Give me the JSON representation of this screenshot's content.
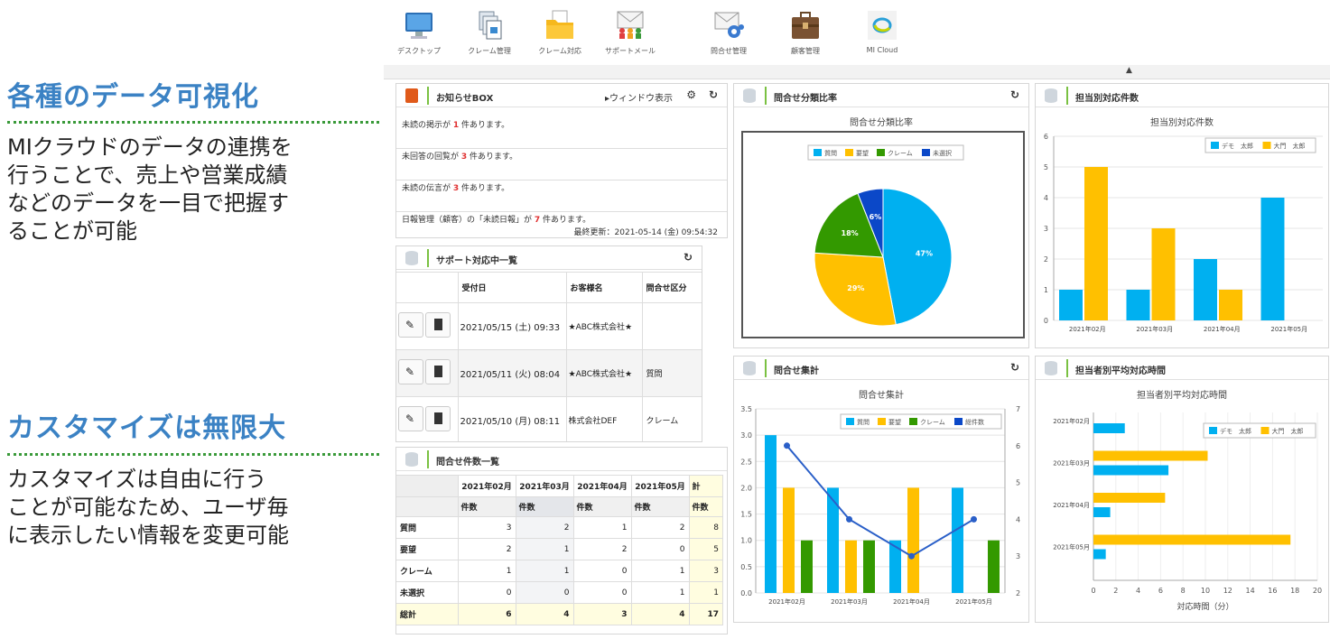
{
  "left": {
    "section1": {
      "heading": "各種のデータ可視化",
      "body": "MIクラウドのデータの連携を\n行うことで、売上や営業成績\nなどのデータを一目で把握す\nることが可能"
    },
    "section2": {
      "heading": "カスタマイズは無限大",
      "body": "カスタマイズは自由に行う\nことが可能なため、ユーザ毎\nに表示したい情報を変更可能"
    }
  },
  "toolbar": [
    {
      "label": "デスクトップ",
      "icon": "monitor-icon"
    },
    {
      "label": "クレーム管理",
      "icon": "documents-icon"
    },
    {
      "label": "クレーム対応",
      "icon": "folder-icon"
    },
    {
      "label": "サポートメール",
      "icon": "mail-people-icon"
    },
    {
      "label": "問合せ管理",
      "icon": "mail-gear-icon"
    },
    {
      "label": "顧客管理",
      "icon": "briefcase-icon"
    },
    {
      "label": "MI Cloud",
      "icon": "cloud-logo-icon"
    }
  ],
  "notice": {
    "title": "お知らせBOX",
    "window_label": "▸ウィンドウ表示",
    "items": [
      {
        "pre": "未読の掲示が ",
        "num": "1",
        "post": " 件あります。"
      },
      {
        "pre": "未回答の回覧が ",
        "num": "3",
        "post": " 件あります。"
      },
      {
        "pre": "未読の伝言が ",
        "num": "3",
        "post": " 件あります。"
      },
      {
        "pre": "日報管理（顧客）の「未読日報」が ",
        "num": "7",
        "post": " 件あります。"
      }
    ],
    "updated": "最終更新：2021-05-14 (金) 09:54:32"
  },
  "support": {
    "title": "サポート対応中一覧",
    "headers": [
      "受付日",
      "お客様名",
      "問合せ区分"
    ],
    "rows": [
      {
        "date": "2021/05/15 (土) 09:33",
        "customer": "★ABC株式会社★",
        "category": ""
      },
      {
        "date": "2021/05/11 (火) 08:04",
        "customer": "★ABC株式会社★",
        "category": "質問"
      },
      {
        "date": "2021/05/10 (月) 08:11",
        "customer": "株式会社DEF",
        "category": "クレーム"
      }
    ]
  },
  "count_table": {
    "title": "問合せ件数一覧",
    "months": [
      "2021年02月",
      "2021年03月",
      "2021年04月",
      "2021年05月",
      "計"
    ],
    "sub": [
      "件数",
      "件数",
      "件数",
      "件数",
      "件数"
    ],
    "rows": [
      {
        "label": "質問",
        "values": [
          "3",
          "2",
          "1",
          "2",
          "8"
        ]
      },
      {
        "label": "要望",
        "values": [
          "2",
          "1",
          "2",
          "0",
          "5"
        ]
      },
      {
        "label": "クレーム",
        "values": [
          "1",
          "1",
          "0",
          "1",
          "3"
        ]
      },
      {
        "label": "未選択",
        "values": [
          "0",
          "0",
          "0",
          "1",
          "1"
        ]
      },
      {
        "label": "総計",
        "values": [
          "6",
          "4",
          "3",
          "4",
          "17"
        ]
      }
    ]
  },
  "panels": {
    "pie": {
      "header": "問合せ分類比率"
    },
    "bar": {
      "header": "担当別対応件数"
    },
    "combo": {
      "header": "問合せ集計"
    },
    "hbar": {
      "header": "担当者別平均対応時間"
    }
  },
  "colors": {
    "c1": "#00b0f0",
    "c2": "#ffc000",
    "c3": "#339900",
    "c4": "#0b48c8",
    "accent": "#7ac142",
    "heading": "#3b82c4"
  },
  "chart_data": [
    {
      "type": "pie",
      "title": "問合せ分類比率",
      "legend": [
        "質問",
        "要望",
        "クレーム",
        "未選択"
      ],
      "values": [
        47,
        29,
        18,
        6
      ],
      "labels": [
        "47%",
        "29%",
        "18%",
        "6%"
      ]
    },
    {
      "type": "bar",
      "title": "担当別対応件数",
      "categories": [
        "2021年02月",
        "2021年03月",
        "2021年04月",
        "2021年05月"
      ],
      "series": [
        {
          "name": "デモ　太郎",
          "values": [
            1,
            1,
            2,
            4
          ]
        },
        {
          "name": "大門　太郎",
          "values": [
            5,
            3,
            1,
            0
          ]
        }
      ],
      "ylim": [
        0,
        6
      ],
      "yticks": [
        "0",
        "1",
        "2",
        "3",
        "4",
        "5",
        "6"
      ]
    },
    {
      "type": "bar",
      "title": "問合せ集計",
      "categories": [
        "2021年02月",
        "2021年03月",
        "2021年04月",
        "2021年05月"
      ],
      "series": [
        {
          "name": "質問",
          "values": [
            3,
            2,
            1,
            2
          ]
        },
        {
          "name": "要望",
          "values": [
            2,
            1,
            2,
            0
          ]
        },
        {
          "name": "クレーム",
          "values": [
            1,
            1,
            0,
            1
          ]
        },
        {
          "name": "総件数",
          "type": "line",
          "axis": "right",
          "values": [
            6,
            4,
            3,
            4
          ]
        }
      ],
      "ylim": [
        0,
        3.5
      ],
      "yticks": [
        "0.0",
        "0.5",
        "1.0",
        "1.5",
        "2.0",
        "2.5",
        "3.0",
        "3.5"
      ],
      "y2lim": [
        2,
        7
      ],
      "y2ticks": [
        "2",
        "3",
        "4",
        "5",
        "6",
        "7"
      ]
    },
    {
      "type": "bar",
      "title": "担当者別平均対応時間",
      "orientation": "horizontal",
      "categories": [
        "2021年02月",
        "2021年03月",
        "2021年04月",
        "2021年05月"
      ],
      "series": [
        {
          "name": "デモ　太郎",
          "values": [
            2.8,
            6.7,
            1.5,
            1.1
          ]
        },
        {
          "name": "大門　太郎",
          "values": [
            0,
            10.2,
            6.4,
            17.6
          ]
        }
      ],
      "xlim": [
        0,
        20
      ],
      "xticks": [
        "0",
        "2",
        "4",
        "6",
        "8",
        "10",
        "12",
        "14",
        "16",
        "18",
        "20"
      ],
      "xlabel": "対応時間（分）"
    }
  ]
}
